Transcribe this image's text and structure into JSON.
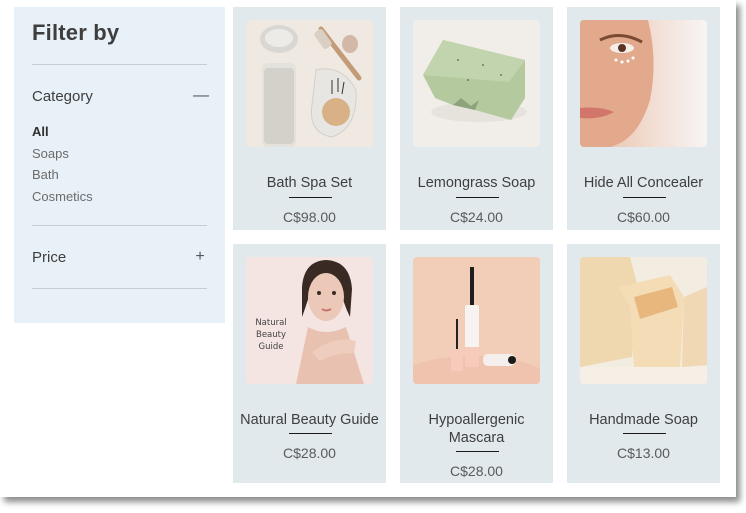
{
  "sidebar": {
    "title": "Filter by",
    "category": {
      "label": "Category",
      "toggle_icon": "minus-icon",
      "toggle_glyph": "—",
      "expanded": true,
      "items": [
        {
          "label": "All",
          "selected": true
        },
        {
          "label": "Soaps",
          "selected": false
        },
        {
          "label": "Bath",
          "selected": false
        },
        {
          "label": "Cosmetics",
          "selected": false
        }
      ]
    },
    "price": {
      "label": "Price",
      "toggle_icon": "plus-icon",
      "toggle_glyph": "+",
      "expanded": false
    }
  },
  "products": [
    {
      "name": "Bath Spa Set",
      "price": "C$98.00",
      "image": "bath-spa-set-image"
    },
    {
      "name": "Lemongrass Soap",
      "price": "C$24.00",
      "image": "lemongrass-soap-image"
    },
    {
      "name": "Hide All Concealer",
      "price": "C$60.00",
      "image": "concealer-face-image"
    },
    {
      "name": "Natural Beauty Guide",
      "price": "C$28.00",
      "image": "beauty-guide-cover-image",
      "image_text": [
        "Natural",
        "Beauty",
        "Guide"
      ]
    },
    {
      "name": "Hypoallergenic Mascara",
      "name_lines": [
        "Hypoallergenic",
        "Mascara"
      ],
      "price": "C$28.00",
      "image": "mascara-image"
    },
    {
      "name": "Handmade Soap",
      "price": "C$13.00",
      "image": "handmade-soap-image"
    }
  ],
  "colors": {
    "sidebar_bg": "#e7f1f7",
    "card_bg": "#e1e9ed",
    "text": "#3e3e3e",
    "price_text": "#5a5a5a"
  }
}
